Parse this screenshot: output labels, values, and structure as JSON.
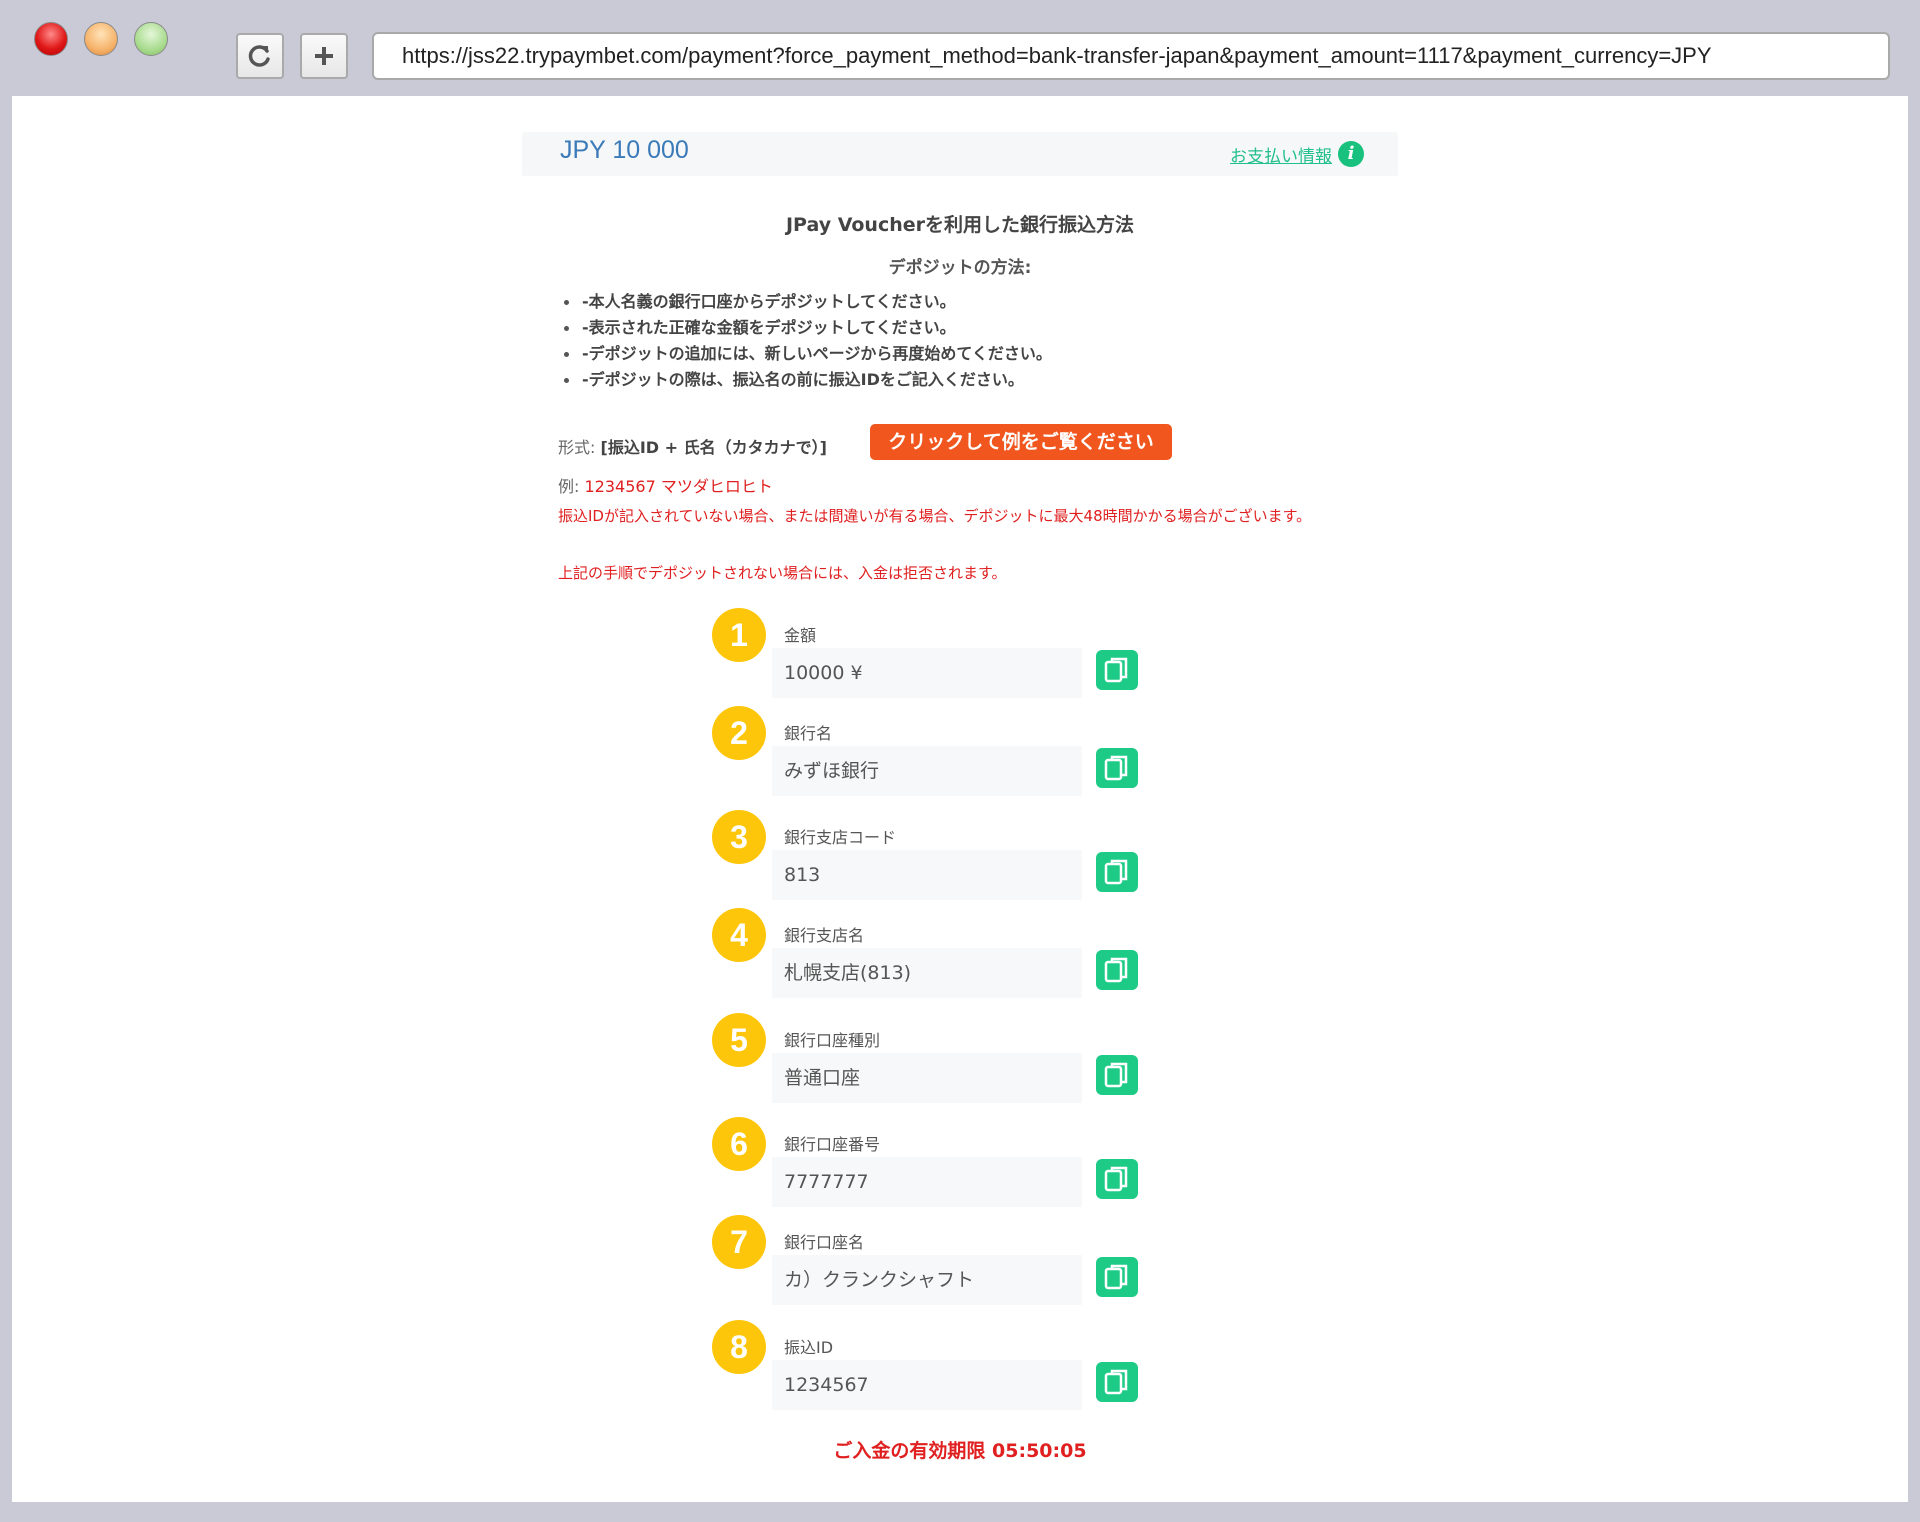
{
  "browser": {
    "url": "https://jss22.trypaymbet.com/payment?force_payment_method=bank-transfer-japan&payment_amount=1117&payment_currency=JPY"
  },
  "header": {
    "amount": "JPY 10 000",
    "info_link": "お支払い情報",
    "info_icon": "i"
  },
  "instructions": {
    "title": "JPay Voucherを利用した銀行振込方法",
    "subtitle": "デポジットの方法:",
    "rules": [
      "-本人名義の銀行口座からデポジットしてください。",
      "-表示された正確な金額をデポジットしてください。",
      "-デポジットの追加には、新しいページから再度始めてください。",
      "-デポジットの際は、振込名の前に振込IDをご記入ください。"
    ],
    "format_label": "形式:",
    "format_value": "[振込ID + 氏名（カタカナで）]",
    "example_button": "クリックして例をご覧ください",
    "example_label": "例:",
    "example_value": "1234567 マツダヒロヒト",
    "warning1": "振込IDが記入されていない場合、または間違いが有る場合、デポジットに最大48時間かかる場合がございます。",
    "warning2": "上記の手順でデポジットされない場合には、入金は拒否されます。"
  },
  "fields": [
    {
      "num": "1",
      "label": "金額",
      "value": "10000 ¥"
    },
    {
      "num": "2",
      "label": "銀行名",
      "value": "みずほ銀行"
    },
    {
      "num": "3",
      "label": "銀行支店コード",
      "value": "813"
    },
    {
      "num": "4",
      "label": "銀行支店名",
      "value": "札幌支店(813)"
    },
    {
      "num": "5",
      "label": "銀行口座種別",
      "value": "普通口座"
    },
    {
      "num": "6",
      "label": "銀行口座番号",
      "value": "7777777"
    },
    {
      "num": "7",
      "label": "銀行口座名",
      "value": "カ）クランクシャフト"
    },
    {
      "num": "8",
      "label": "振込ID",
      "value": "1234567"
    }
  ],
  "timer": "ご入金の有効期限 05:50:05",
  "colors": {
    "accent_green": "#1dcb86",
    "badge_yellow": "#fdc60a",
    "alert_red": "#e02020",
    "button_orange": "#f0561e",
    "amount_blue": "#3a7ab8"
  }
}
